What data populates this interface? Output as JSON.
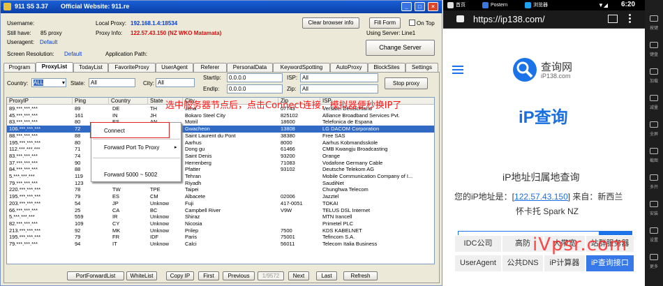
{
  "app": {
    "icon": "911-logo-icon",
    "title": "911 S5 3.37",
    "website": "Official Website:  911.re"
  },
  "window_controls": [
    "_",
    "□",
    "×"
  ],
  "info": {
    "username_label": "Username:",
    "username_value": "",
    "still_have_label": "Still have:",
    "still_have_value": "85  proxy",
    "useragent_label": "Useragent:",
    "useragent_value": "Default",
    "screen_res_label": "Screen Resolution:",
    "screen_res_value": "Default",
    "local_proxy_label": "Local Proxy:",
    "local_proxy_value": "192.168.1.4:18534",
    "proxy_info_label": "Proxy Info:",
    "proxy_info_value": "122.57.43.150 (NZ WKO Matamata)",
    "app_path_label": "Application Path:",
    "app_path_value": "",
    "using_server": "Using Server: Line1"
  },
  "buttons": {
    "clear_browser": "Clear browser info",
    "fill_form": "Fill Form",
    "on_top": "On Top",
    "change_server": "Change Server",
    "stop_proxy": "Stop proxy"
  },
  "tabs": [
    "Program",
    "ProxyList",
    "TodayList",
    "FavoriteProxy",
    "UserAgent",
    "Referer",
    "PersonalData",
    "KeywordSpotting",
    "AutoProxy",
    "BlockSites",
    "Settings"
  ],
  "filters": {
    "country_label": "Country:",
    "country_value": "ALL",
    "state_label": "State:",
    "state_value": "All",
    "city_label": "City:",
    "city_value": "All",
    "startip_label": "StartIp:",
    "startip_value": "0.0.0.0",
    "endip_label": "EndIp:",
    "endip_value": "0.0.0.0",
    "isp_label": "ISP:",
    "isp_value": "All",
    "zip_label": "Zip:",
    "zip_value": "All"
  },
  "table": {
    "columns": [
      "ProxyIP",
      "Ping",
      "Country",
      "State",
      "City",
      "Zip",
      "ISP"
    ],
    "rows": [
      [
        "89.***.***.***",
        "89",
        "DE",
        "TH",
        "Jena",
        "07743",
        "Versatel Deutschland"
      ],
      [
        "45.***.***.***",
        "161",
        "IN",
        "JH",
        "Bokaro Steel City",
        "825102",
        "Alliance Broadband Services Pvt."
      ],
      [
        "83.***.***.***",
        "80",
        "ES",
        "AN",
        "Motril",
        "18600",
        "Telefonica de Espana"
      ],
      [
        "106.***.***.***",
        "72",
        "KR",
        "",
        "Gwacheon",
        "13808",
        "LG DACOM Corporation"
      ],
      [
        "88.***.***.***",
        "88",
        "",
        "",
        "Saint Laurent du Pont",
        "38380",
        "Free SAS"
      ],
      [
        "195.***.***.***",
        "80",
        "",
        "",
        "Aarhus",
        "8000",
        "Aarhus Kobmandsskole"
      ],
      [
        "112.***.***.***",
        "71",
        "",
        "",
        "Dong gu",
        "61466",
        "CMB Kwangju Broadcasting"
      ],
      [
        "83.***.***.***",
        "74",
        "",
        "",
        "Saint Denis",
        "93200",
        "Orange"
      ],
      [
        "37.***.***.***",
        "90",
        "",
        "",
        "Herrenberg",
        "71083",
        "Vodafone Germany Cable"
      ],
      [
        "84.***.***.***",
        "88",
        "",
        "",
        "Pfatter",
        "93102",
        "Deutsche Telekom AG"
      ],
      [
        "5.***.***.***",
        "119",
        "",
        "",
        "Tehran",
        "",
        "Mobile Communication Company of I..."
      ],
      [
        "79.***.***.***",
        "123",
        "",
        "",
        "Riyadh",
        "",
        "SaudiNet"
      ],
      [
        "220.***.***.***",
        "78",
        "TW",
        "TPE",
        "Taipei",
        "",
        "Chunghwa Telecom"
      ],
      [
        "195.***.***.***",
        "79",
        "ES",
        "CM",
        "Albacete",
        "02006",
        "Jazztel"
      ],
      [
        "203.***.***.***",
        "54",
        "JP",
        "Unknow",
        "Fuji",
        "417-0051",
        "TOKAI"
      ],
      [
        "66.***.***.***",
        "25",
        "CA",
        "BC",
        "Campbell River",
        "V9W",
        "TELUS DSL Internet"
      ],
      [
        "5.***.***.***",
        "559",
        "IR",
        "Unknow",
        "Shiraz",
        "",
        "MTN Irancell"
      ],
      [
        "82.***.***.***",
        "109",
        "CY",
        "Unknow",
        "Nicosia",
        "",
        "Primetel PLC"
      ],
      [
        "213.***.***.***",
        "92",
        "MK",
        "Unknow",
        "Prilep",
        "7500",
        "KDS KABELNET"
      ],
      [
        "195.***.***.***",
        "79",
        "FR",
        "IDF",
        "Paris",
        "75001",
        "Tefincom S.A."
      ],
      [
        "79.***.***.***",
        "94",
        "IT",
        "Unknow",
        "Calci",
        "56011",
        "Telecom Italia Business"
      ]
    ]
  },
  "context_menu": [
    "Connect",
    "Forward Port To Proxy",
    "Forward 5000 ~ 5002"
  ],
  "overlay_text": "选中服务器节点后，点击Connect连接，模拟器便秒换IP了",
  "bottom_buttons": [
    "PortForwardList",
    "WhiteList",
    "Copy IP",
    "First",
    "Previous",
    "1/9572",
    "Next",
    "Last",
    "Refresh"
  ],
  "phone": {
    "status_tabs": [
      "首页",
      "Postern",
      "浏览器"
    ],
    "time": "6:20",
    "url": "https://ip138.com/",
    "logo_text": "查询网",
    "logo_sub": "iP138.com",
    "title": "iP查询",
    "subtitle": "iP地址归属地查询",
    "your_ip_prefix": "您的iP地址是：[",
    "your_ip": "122.57.43.150",
    "your_ip_suffix": "] 来自：新西兰",
    "location_line2": "怀卡托 Spark NZ",
    "search_placeholder": "请输入iP地址或者域名",
    "search_button": "查询",
    "grid": [
      "IDC公司",
      "高防",
      "大带宽",
      "站群服务器",
      "UserAgent",
      "公共DNS",
      "iP计算器",
      "iP查询接口"
    ],
    "watermark": "iVpsr.com"
  },
  "emulator_sidebar": [
    "按键",
    "键盘",
    "加载",
    "减量",
    "全屏",
    "截图",
    "多开",
    "安装",
    "设置",
    "更多"
  ]
}
